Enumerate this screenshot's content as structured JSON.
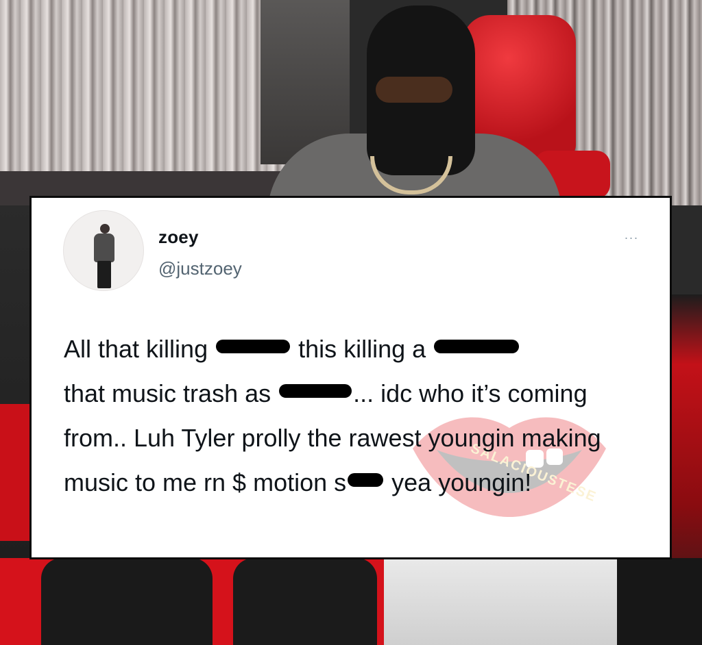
{
  "tweet": {
    "display_name": "zoey",
    "handle": "@justzoey",
    "more_icon": "···",
    "text_segments": [
      "All that killing ",
      "this killing a ",
      "that music trash as ",
      "... idc who it’s coming from.. Luh Tyler prolly the rawest youngin making music to me rn $ motion s",
      " yea youngin!"
    ]
  },
  "watermark": {
    "text": "SALACIOUSTESE",
    "color": "#e0141b"
  },
  "colors": {
    "card_bg": "#ffffff",
    "text": "#0f1419",
    "handle": "#536471",
    "seat_red": "#d5121b"
  }
}
